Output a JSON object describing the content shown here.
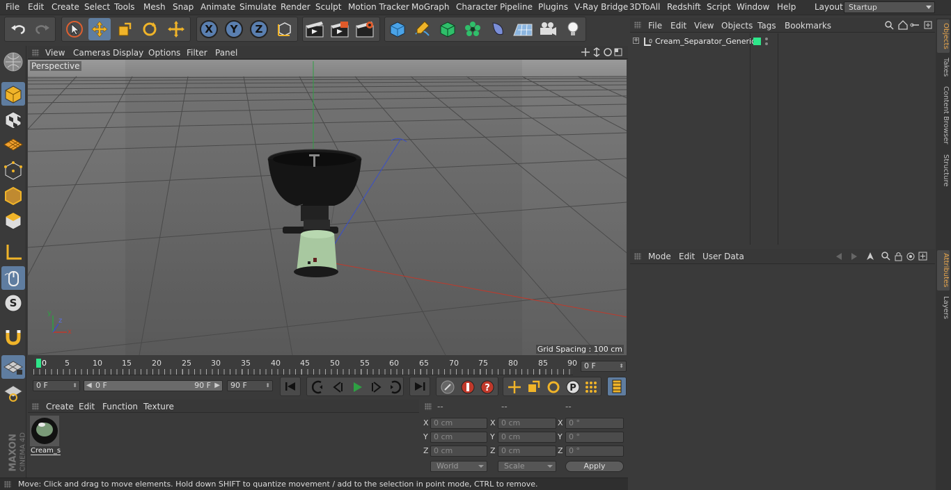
{
  "menubar": {
    "items": [
      "File",
      "Edit",
      "Create",
      "Select",
      "Tools",
      "Mesh",
      "Snap",
      "Animate",
      "Simulate",
      "Render",
      "Sculpt",
      "Motion Tracker",
      "MoGraph",
      "Character",
      "Pipeline",
      "Plugins",
      "V-Ray Bridge",
      "3DToAll",
      "Redshift",
      "Script",
      "Window",
      "Help"
    ],
    "layout_label": "Layout:",
    "layout_value": "Startup"
  },
  "toolbar": {
    "axis_x": "X",
    "axis_y": "Y",
    "axis_z": "Z"
  },
  "viewport": {
    "menu": [
      "View",
      "Cameras",
      "Display",
      "Options",
      "Filter",
      "Panel"
    ],
    "label": "Perspective",
    "grid_spacing": "Grid Spacing : 100 cm",
    "axis_x": "x",
    "axis_y": "y",
    "axis_z": "z"
  },
  "timeline": {
    "ticks": [
      "0",
      "5",
      "10",
      "15",
      "20",
      "25",
      "30",
      "35",
      "40",
      "45",
      "50",
      "55",
      "60",
      "65",
      "70",
      "75",
      "80",
      "85",
      "90"
    ],
    "current_frame": "0 F"
  },
  "playbar": {
    "start_field": "0 F",
    "range_start": "0 F",
    "range_end": "90 F",
    "end_field": "90 F"
  },
  "material_manager": {
    "menu": [
      "Create",
      "Edit",
      "Function",
      "Texture"
    ],
    "materials": [
      {
        "name": "Cream_s"
      }
    ]
  },
  "coordinates": {
    "headers": [
      "--",
      "--",
      "--"
    ],
    "rows": [
      {
        "axis": "X",
        "pos": "0 cm",
        "size_axis": "X",
        "size": "0 cm",
        "rot_axis": "X",
        "rot": "0 °"
      },
      {
        "axis": "Y",
        "pos": "0 cm",
        "size_axis": "Y",
        "size": "0 cm",
        "rot_axis": "Y",
        "rot": "0 °"
      },
      {
        "axis": "Z",
        "pos": "0 cm",
        "size_axis": "Z",
        "size": "0 cm",
        "rot_axis": "Z",
        "rot": "0 °"
      }
    ],
    "mode_select": "World",
    "scale_select": "Scale",
    "apply_label": "Apply"
  },
  "object_manager": {
    "menu": [
      "File",
      "Edit",
      "View",
      "Objects",
      "Tags",
      "Bookmarks"
    ],
    "objects": [
      {
        "name": "Cream_Separator_Generic"
      }
    ]
  },
  "attribute_manager": {
    "menu": [
      "Mode",
      "Edit",
      "User Data"
    ]
  },
  "right_tabs": [
    "Objects",
    "Takes",
    "Content Browser",
    "Structure",
    "Attributes",
    "Layers"
  ],
  "status": {
    "text": "Move: Click and drag to move elements. Hold down SHIFT to quantize movement / add to the selection in point mode, CTRL to remove."
  },
  "branding": {
    "maxon": "MAXON",
    "cinema": "CINEMA 4D"
  },
  "colors": {
    "accent_green": "#2ee68a",
    "x_axis": "#c0392b",
    "y_axis": "#2ea043",
    "z_axis": "#3a4fc8"
  }
}
